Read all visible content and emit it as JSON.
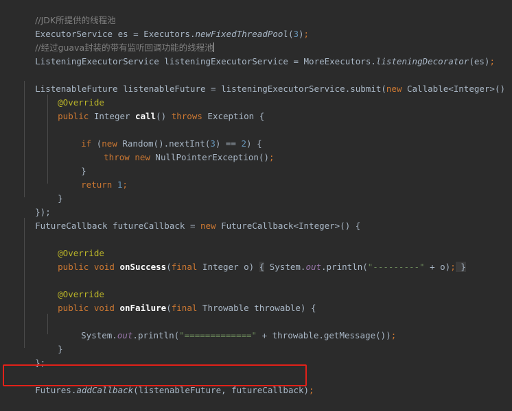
{
  "editor": {
    "theme_name": "darcula",
    "background_color": "#2b2b2b",
    "default_text_color": "#a9b7c6",
    "comment_color": "#808080",
    "keyword_color": "#cc7832",
    "number_color": "#6897bb",
    "string_color": "#6a8759",
    "annotation_color": "#bbb529",
    "field_color": "#9876aa",
    "indent_guide_color": "#4b4b4b",
    "annotation_box_color": "#e32119",
    "language": "Java"
  },
  "code": {
    "line_01_comment": "//JDK所提供的线程池",
    "line_02_type": "ExecutorService",
    "line_02_var": " es ",
    "line_02_eq": "= ",
    "line_02_class": "Executors.",
    "line_02_method": "newFixedThreadPool",
    "line_02_paren_open": "(",
    "line_02_number": "3",
    "line_02_paren_close": ")",
    "line_02_semi": ";",
    "line_03_comment": "//经过guava封装的带有监听回调功能的线程池",
    "line_04_type": "ListeningExecutorService listeningExecutorService ",
    "line_04_eq": "= ",
    "line_04_class": "MoreExecutors.",
    "line_04_method": "listeningDecorator",
    "line_04_args": "(es)",
    "line_04_semi": ";",
    "line_06_text": "ListenableFuture listenableFuture = listeningExecutorService.submit",
    "line_06_paren": "(",
    "line_06_new": "new",
    "line_06_tail": " Callable<Integer>()",
    "line_07_annotation": "@Override",
    "line_08_modifier": "public",
    "line_08_type": " Integer ",
    "line_08_method": "call",
    "line_08_parens": "() ",
    "line_08_throws": "throws",
    "line_08_exception": " Exception ",
    "line_08_brace": "{",
    "line_10_if": "if",
    "line_10_p1": " (",
    "line_10_new": "new",
    "line_10_mid": " Random().nextInt(",
    "line_10_num1": "3",
    "line_10_mid2": ") == ",
    "line_10_num2": "2",
    "line_10_tail": ") {",
    "line_11_throw": "throw",
    "line_11_new": " new",
    "line_11_rest": " NullPointerException()",
    "line_11_semi": ";",
    "line_12_brace": "}",
    "line_13_return": "return",
    "line_13_num": " 1",
    "line_13_semi": ";",
    "line_14_brace": "}",
    "line_15_close": "});",
    "line_16_type": "FutureCallback futureCallback ",
    "line_16_eq": "= ",
    "line_16_new": "new",
    "line_16_tail": " FutureCallback<Integer>() {",
    "line_18_annotation": "@Override",
    "line_19_modifier": "public",
    "line_19_void": " void",
    "line_19_method": " onSuccess",
    "line_19_p1": "(",
    "line_19_final": "final",
    "line_19_params": " Integer o) ",
    "line_19_brace_open": "{",
    "line_19_sys": " System.",
    "line_19_out": "out",
    "line_19_println": ".println(",
    "line_19_string": "\"---------\"",
    "line_19_concat": " + o)",
    "line_19_semi": ";",
    "line_19_brace_close": " }",
    "line_21_annotation": "@Override",
    "line_22_modifier": "public",
    "line_22_void": " void",
    "line_22_method": " onFailure",
    "line_22_p1": "(",
    "line_22_final": "final",
    "line_22_params": " Throwable throwable) {",
    "line_24_sys": "System.",
    "line_24_out": "out",
    "line_24_println": ".println(",
    "line_24_string": "\"=============\"",
    "line_24_concat": " + throwable.getMessage())",
    "line_24_semi": ";",
    "line_25_brace": "}",
    "line_26_close": "};",
    "line_28_class": "Futures.",
    "line_28_method": "addCallback",
    "line_28_args": "(listenableFuture, futureCallback)",
    "line_28_semi": ";"
  }
}
